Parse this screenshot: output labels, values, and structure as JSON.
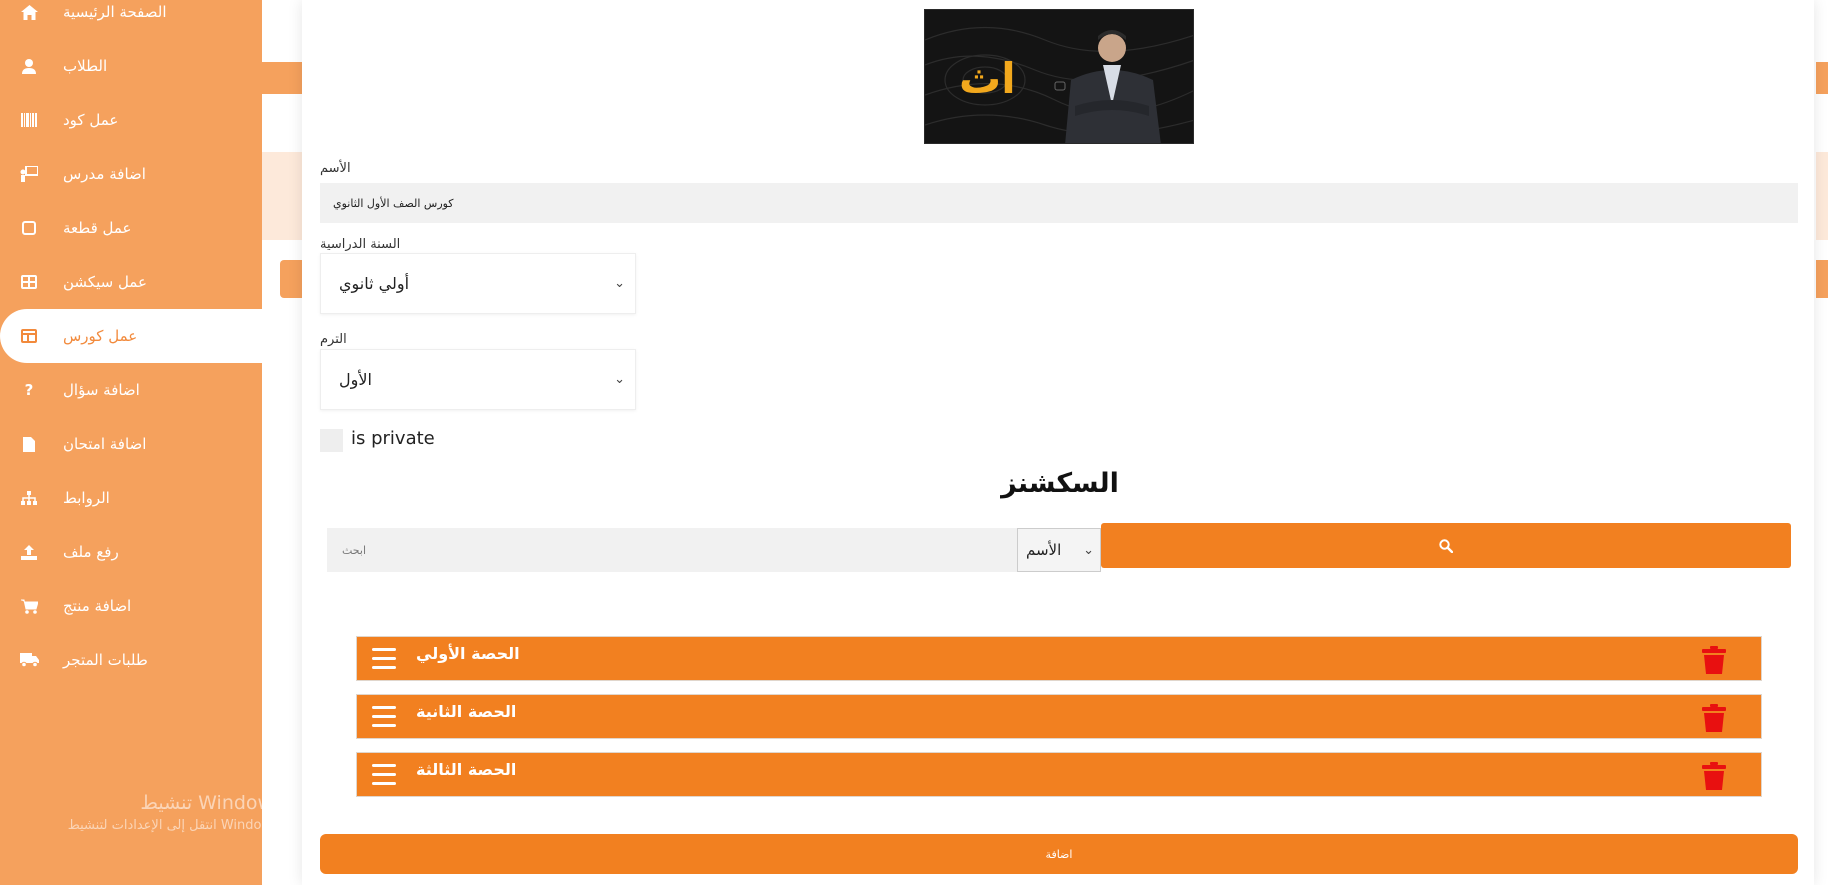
{
  "sidebar": {
    "items": [
      {
        "label": "الصفحة الرئيسية",
        "icon": "home-icon"
      },
      {
        "label": "الطلاب",
        "icon": "user-icon"
      },
      {
        "label": "عمل كود",
        "icon": "barcode-icon"
      },
      {
        "label": "اضافة مدرس",
        "icon": "teacher-icon"
      },
      {
        "label": "عمل قطعة",
        "icon": "square-icon"
      },
      {
        "label": "عمل سيكشن",
        "icon": "grid-icon"
      },
      {
        "label": "عمل كورس",
        "icon": "table-icon",
        "active": true
      },
      {
        "label": "اضافة سؤال",
        "icon": "question-icon"
      },
      {
        "label": "اضافة امتحان",
        "icon": "document-icon"
      },
      {
        "label": "الروابط",
        "icon": "sitemap-icon"
      },
      {
        "label": "رفع ملف",
        "icon": "upload-icon"
      },
      {
        "label": "اضافة منتج",
        "icon": "cart-icon"
      },
      {
        "label": "طلبات المتجر",
        "icon": "truck-icon"
      }
    ],
    "watermark_line1": "تنشيط Windows",
    "watermark_line2": "انتقل إلى الإعدادات لتنشيط Windows."
  },
  "form": {
    "banner_text": "اث",
    "name_label": "الأسم",
    "name_value": "كورس الصف الأول الثانوي",
    "year_label": "السنة الدراسية",
    "year_value": "أولي ثانوي",
    "term_label": "الترم",
    "term_value": "الأول",
    "private_label": "is private"
  },
  "sections": {
    "title": "السكشنز",
    "search_placeholder": "ابحث",
    "search_by": "الأسم",
    "items": [
      {
        "title": "الحصة الأولي"
      },
      {
        "title": "الحصة الثانية"
      },
      {
        "title": "الحصة الثالثة"
      }
    ]
  },
  "add_button_label": "اضافة",
  "colors": {
    "sidebar": "#f5a15d",
    "accent": "#f28020",
    "delete": "#e81010"
  }
}
